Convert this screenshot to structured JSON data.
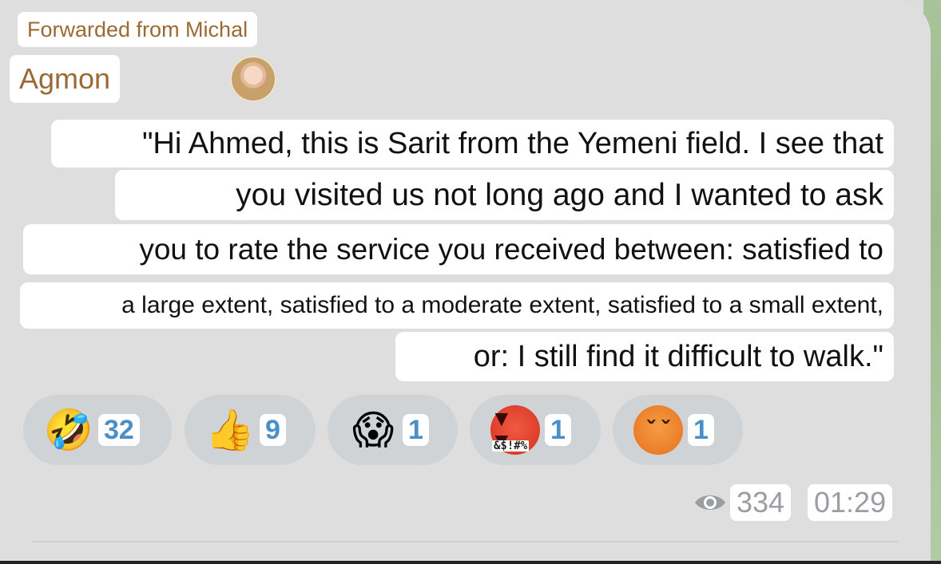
{
  "message": {
    "forwarded_label": "Forwarded from Michal",
    "sender_name": "Agmon",
    "lines": [
      "\"Hi Ahmed, this is Sarit from the Yemeni field. I see that",
      "you visited us not long ago and I wanted to ask",
      "you to rate the service you received between: satisfied to",
      "a large extent, satisfied to a moderate extent, satisfied to a small extent,",
      "or: I still find it difficult to walk.\""
    ]
  },
  "reactions": [
    {
      "emoji": "🤣",
      "icon": "rolling-laughing-icon",
      "count": "32"
    },
    {
      "emoji": "👍",
      "icon": "thumbs-up-icon",
      "count": "9"
    },
    {
      "emoji": "😱",
      "icon": "screaming-face-icon",
      "count": "1"
    },
    {
      "emoji": "",
      "icon": "cursing-face-icon",
      "count": "1",
      "badge": "&$!#%"
    },
    {
      "emoji": "",
      "icon": "angry-face-icon",
      "count": "1"
    }
  ],
  "footer": {
    "views": "334",
    "time": "01:29"
  },
  "colors": {
    "accent_sender": "#9a6a35",
    "reaction_count": "#4a8fc7",
    "meta_text": "#9a9ea3"
  }
}
